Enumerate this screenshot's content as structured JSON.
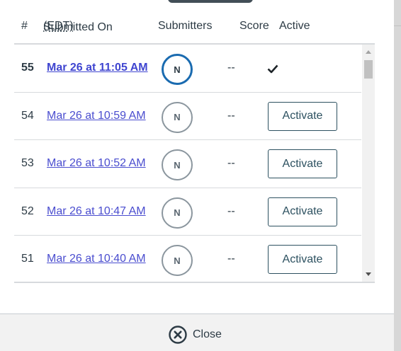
{
  "table": {
    "headers": {
      "number": "#",
      "submitted_on": "Submitted On",
      "timezone": "(EDT)",
      "submitters": "Submitters",
      "score": "Score",
      "active": "Active"
    },
    "rows": [
      {
        "number": "55",
        "date": "Mar 26 at 11:05 AM",
        "submitter_initial": "N",
        "score": "--",
        "active": true
      },
      {
        "number": "54",
        "date": "Mar 26 at 10:59 AM",
        "submitter_initial": "N",
        "score": "--",
        "active": false,
        "button_label": "Activate"
      },
      {
        "number": "53",
        "date": "Mar 26 at 10:52 AM",
        "submitter_initial": "N",
        "score": "--",
        "active": false,
        "button_label": "Activate"
      },
      {
        "number": "52",
        "date": "Mar 26 at 10:47 AM",
        "submitter_initial": "N",
        "score": "--",
        "active": false,
        "button_label": "Activate"
      },
      {
        "number": "51",
        "date": "Mar 26 at 10:40 AM",
        "submitter_initial": "N",
        "score": "--",
        "active": false,
        "button_label": "Activate"
      }
    ]
  },
  "footer": {
    "close_label": "Close",
    "close_icon": "close-circle-icon"
  },
  "colors": {
    "link": "#4a4dcf",
    "active_avatar_border": "#1a6bb0",
    "button_border": "#2d5160",
    "footer_bg": "#f2f2f2"
  }
}
